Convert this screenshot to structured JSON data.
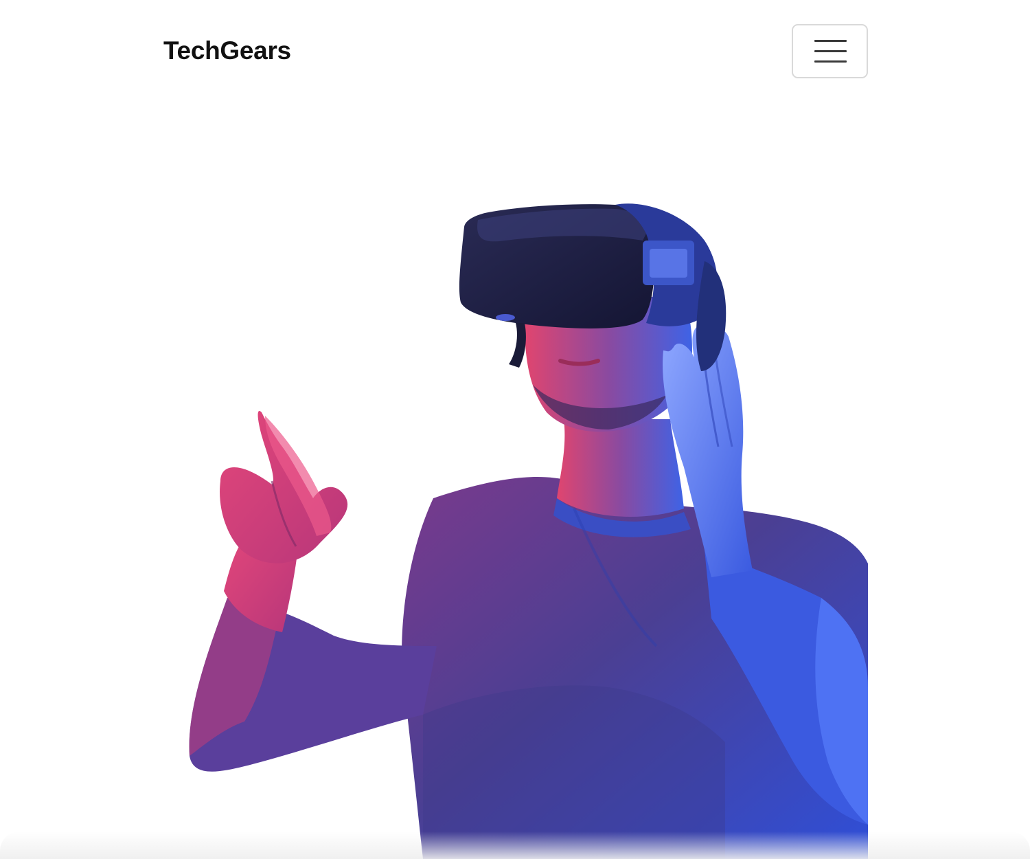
{
  "navbar": {
    "brand": "TechGears",
    "toggler_icon": "hamburger-menu-icon"
  },
  "hero": {
    "image_subject": "man-wearing-vr-headset",
    "colors": {
      "blue": "#2f4bd8",
      "magenta": "#d83a78",
      "purple": "#4a3f8c",
      "headset": "#1e1f3a"
    }
  }
}
